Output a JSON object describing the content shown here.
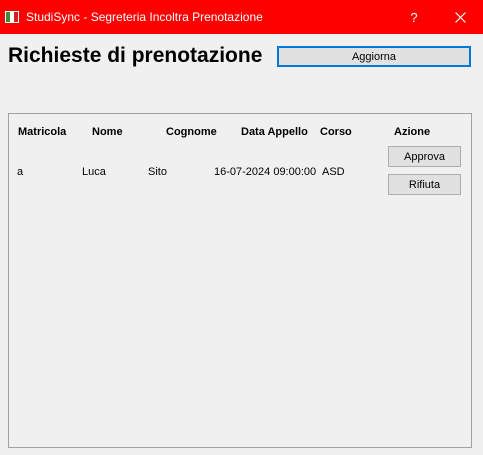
{
  "window": {
    "title": "StudiSync - Segreteria Incoltra Prenotazione",
    "help_label": "?",
    "title_color": "#ff0000",
    "accent_color": "#0078d7",
    "icon": "app-flag-icon"
  },
  "header": {
    "title": "Richieste di prenotazione",
    "refresh_label": "Aggiorna"
  },
  "table": {
    "columns": [
      "Matricola",
      "Nome",
      "Cognome",
      "Data Appello",
      "Corso",
      "Azione"
    ],
    "rows": [
      {
        "matricola": "a",
        "nome": "Luca",
        "cognome": "Sito",
        "data_appello": "16-07-2024 09:00:00",
        "corso": "ASD",
        "approve_label": "Approva",
        "reject_label": "Rifiuta"
      }
    ]
  }
}
